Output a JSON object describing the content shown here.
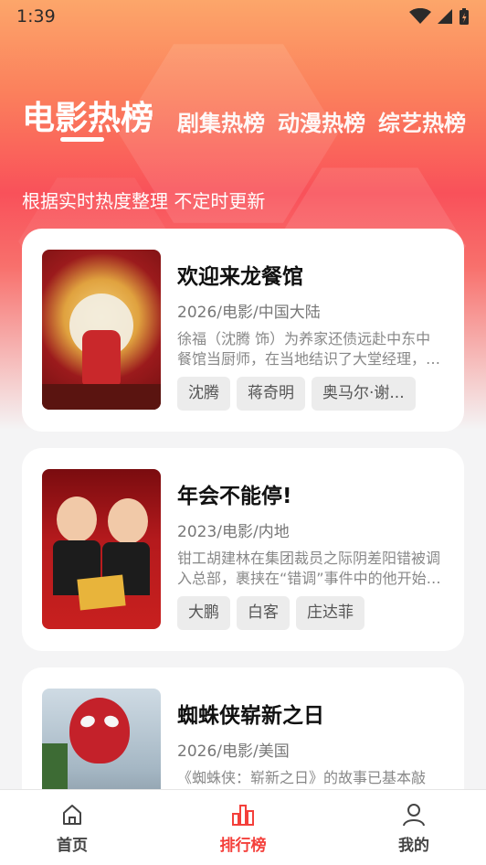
{
  "status_bar": {
    "time": "1:39"
  },
  "tabs": [
    {
      "label": "电影热榜",
      "active": true
    },
    {
      "label": "剧集热榜",
      "active": false
    },
    {
      "label": "动漫热榜",
      "active": false
    },
    {
      "label": "综艺热榜",
      "active": false
    }
  ],
  "subtitle": "根据实时热度整理 不定时更新",
  "movies": [
    {
      "title": "欢迎来龙餐馆",
      "meta": "2026/电影/中国大陆",
      "desc": "徐福（沈腾 饰）为养家还债远赴中东中餐馆当厨师，在当地结识了大堂经理，却意外卷入一场风波。",
      "tags": [
        "沈腾",
        "蒋奇明",
        "奥马尔·谢..."
      ]
    },
    {
      "title": "年会不能停!",
      "meta": "2023/电影/内地",
      "desc": "钳工胡建林在集团裁员之际阴差阳错被调入总部，裹挟在“错调”事件中的他开始了职场新生活。",
      "tags": [
        "大鹏",
        "白客",
        "庄达菲"
      ]
    },
    {
      "title": "蜘蛛侠崭新之日",
      "meta": "2026/电影/美国",
      "desc": "《蜘蛛侠：崭新之日》的故事已基本敲定，编剧正在创作剧本。",
      "tags": []
    }
  ],
  "bottom_nav": [
    {
      "label": "首页",
      "icon": "home-icon",
      "active": false
    },
    {
      "label": "排行榜",
      "icon": "chart-icon",
      "active": true
    },
    {
      "label": "我的",
      "icon": "person-icon",
      "active": false
    }
  ],
  "colors": {
    "accent": "#f43f3a",
    "hero_top": "#fca66a",
    "hero_mid": "#f9515a"
  }
}
